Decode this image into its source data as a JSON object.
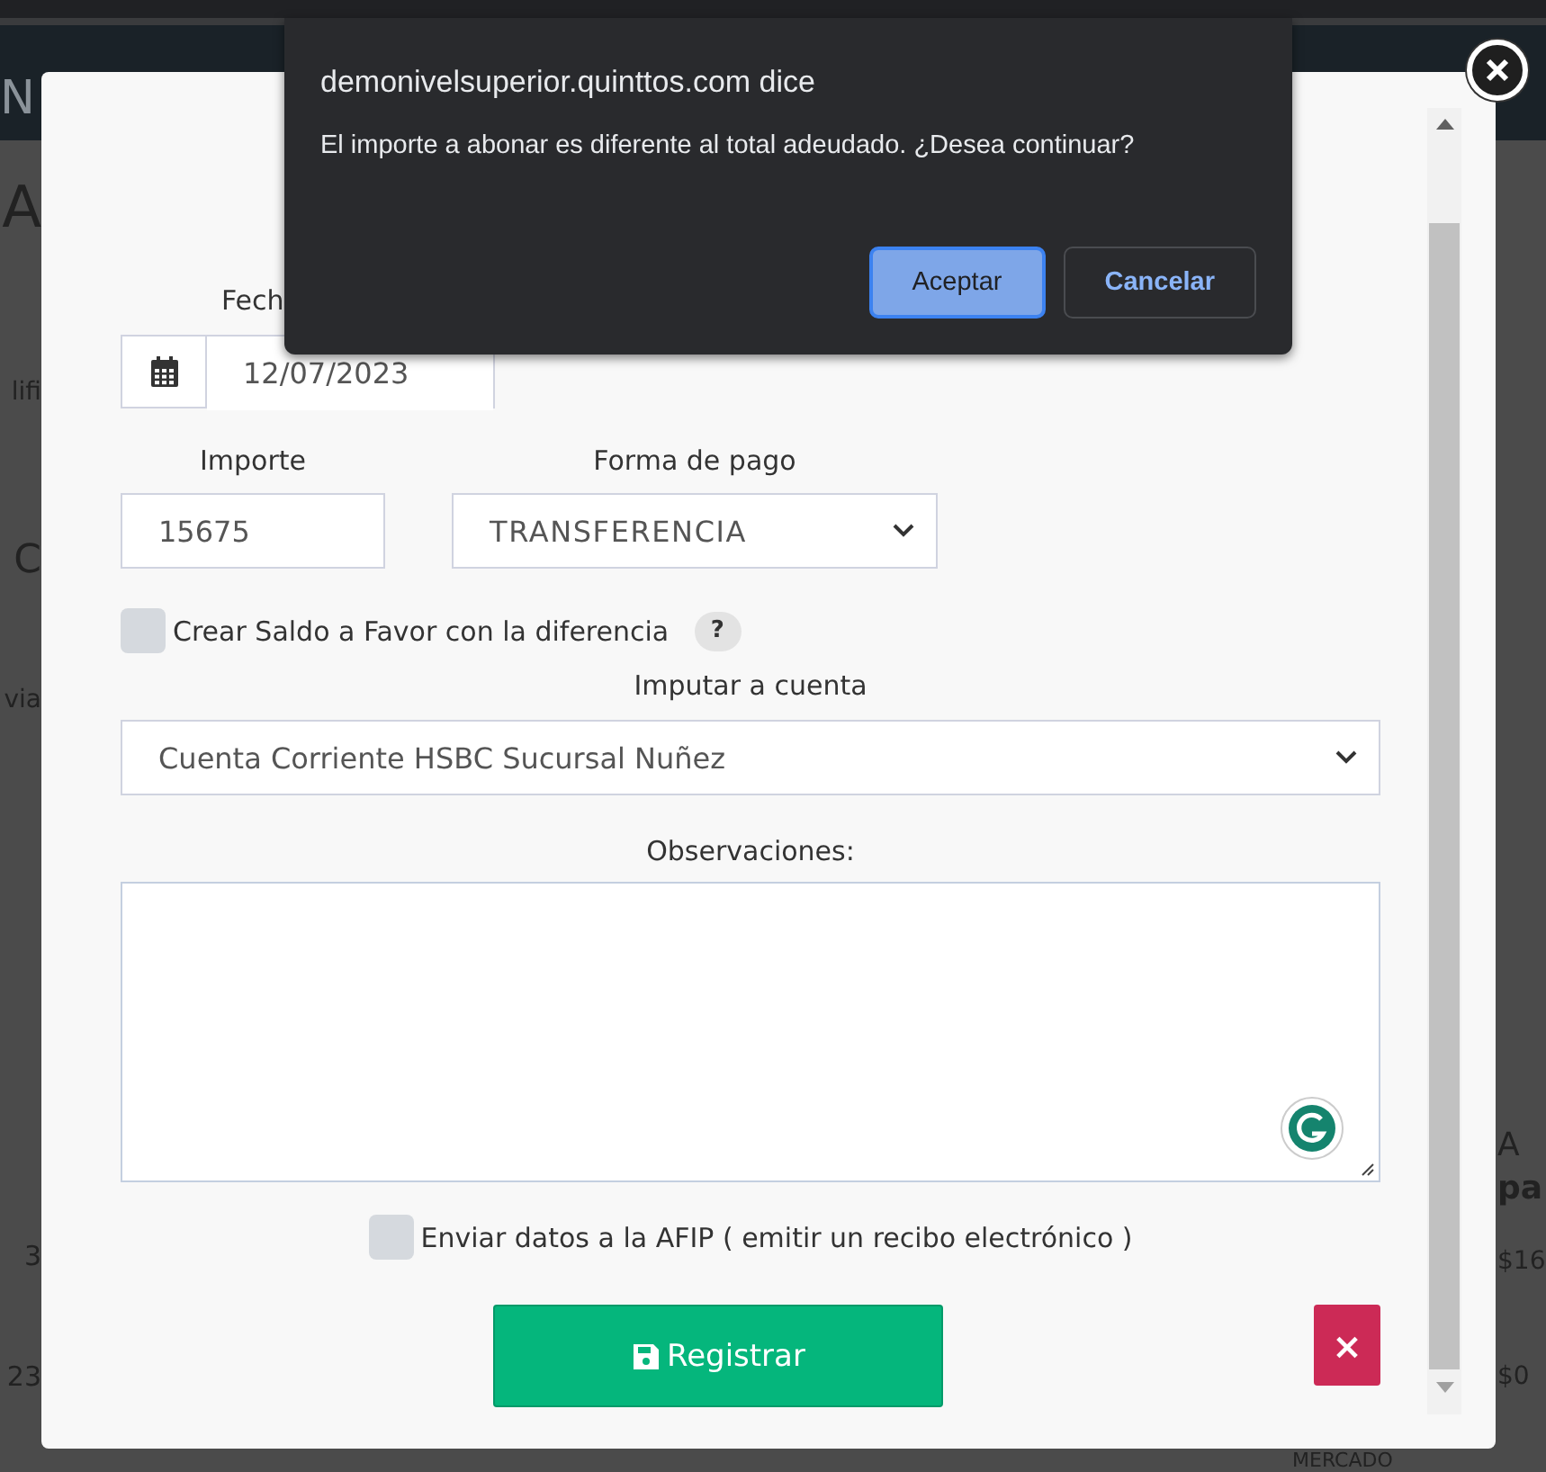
{
  "background": {
    "navbar_text": "N",
    "left_fragments": [
      "A",
      "lifi",
      "C",
      "via",
      "3",
      "23"
    ],
    "right_fragments": [
      "A",
      "pa",
      "$16",
      "$0"
    ],
    "bottom_fragment": "MERCADO"
  },
  "dialog": {
    "title": "demonivelsuperior.quinttos.com dice",
    "message": "El importe a abonar es diferente al total adeudado. ¿Desea continuar?",
    "buttons": [
      {
        "label": "Aceptar",
        "selected": true
      },
      {
        "label": "Cancelar",
        "selected": false
      }
    ]
  },
  "form": {
    "fecha": {
      "label": "Fech",
      "value": "12/07/2023"
    },
    "importe": {
      "label": "Importe",
      "value": "15675"
    },
    "forma_de_pago": {
      "label": "Forma de pago",
      "value": "TRANSFERENCIA"
    },
    "saldo_a_favor": {
      "label": "Crear Saldo a Favor con la diferencia",
      "checked": false,
      "help": "?"
    },
    "imputar": {
      "label": "Imputar a cuenta",
      "value": "Cuenta Corriente HSBC Sucursal Nuñez"
    },
    "observaciones": {
      "label": "Observaciones:"
    },
    "afip": {
      "label": "Enviar datos a la AFIP ( emitir un recibo electrónico )",
      "checked": false
    },
    "submit": "Registrar",
    "cancel": "×"
  }
}
